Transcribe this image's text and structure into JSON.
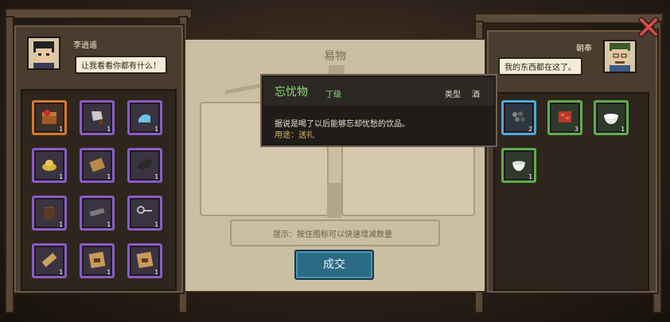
{
  "left": {
    "npc_name": "李逍遥",
    "speech": "让我看看你都有什么！",
    "items": [
      {
        "icon": "treasure-chest-icon",
        "count": "1",
        "rarity": "orange"
      },
      {
        "icon": "cleaver-icon",
        "count": "1",
        "rarity": "purple"
      },
      {
        "icon": "jade-shoes-icon",
        "count": "1",
        "rarity": "purple"
      },
      {
        "icon": "gold-ingot-icon",
        "count": "1",
        "rarity": "purple"
      },
      {
        "icon": "bamboo-scroll-icon",
        "count": "1",
        "rarity": "purple"
      },
      {
        "icon": "dark-leaf-icon",
        "count": "1",
        "rarity": "purple"
      },
      {
        "icon": "clay-jar-icon",
        "count": "1",
        "rarity": "purple"
      },
      {
        "icon": "iron-bar-icon",
        "count": "1",
        "rarity": "purple"
      },
      {
        "icon": "key-icon",
        "count": "1",
        "rarity": "purple"
      },
      {
        "icon": "scroll-icon",
        "count": "1",
        "rarity": "purple"
      },
      {
        "icon": "recipe-paper-icon",
        "count": "1",
        "rarity": "purple"
      },
      {
        "icon": "recipe-paper-icon",
        "count": "1",
        "rarity": "purple"
      }
    ]
  },
  "right": {
    "npc_name": "朝奉",
    "speech": "我的东西都在这了。",
    "items": [
      {
        "icon": "stones-icon",
        "count": "2",
        "rarity": "blue"
      },
      {
        "icon": "red-meat-icon",
        "count": "3",
        "rarity": "green"
      },
      {
        "icon": "rice-bowl-icon",
        "count": "1",
        "rarity": "green"
      },
      {
        "icon": "tea-bowl-icon",
        "count": "1",
        "rarity": "green"
      }
    ]
  },
  "center": {
    "title": "易物",
    "hint": "提示：按住图标可以快速增减数量",
    "deal_label": "成交"
  },
  "tooltip": {
    "name": "忘忧物",
    "grade": "丁级",
    "type_label": "类型",
    "type_value": "酒",
    "description": "据说是喝了以后能够忘却忧愁的饮品。",
    "use": "用途：送礼"
  },
  "colors": {
    "purple": "#8a5cc4",
    "orange": "#d67a2b",
    "blue": "#4aa9d8",
    "green": "#5fae4b",
    "deal": "#2d6a83",
    "tip_name": "#8fdc7a",
    "close": "#d64a4a"
  }
}
